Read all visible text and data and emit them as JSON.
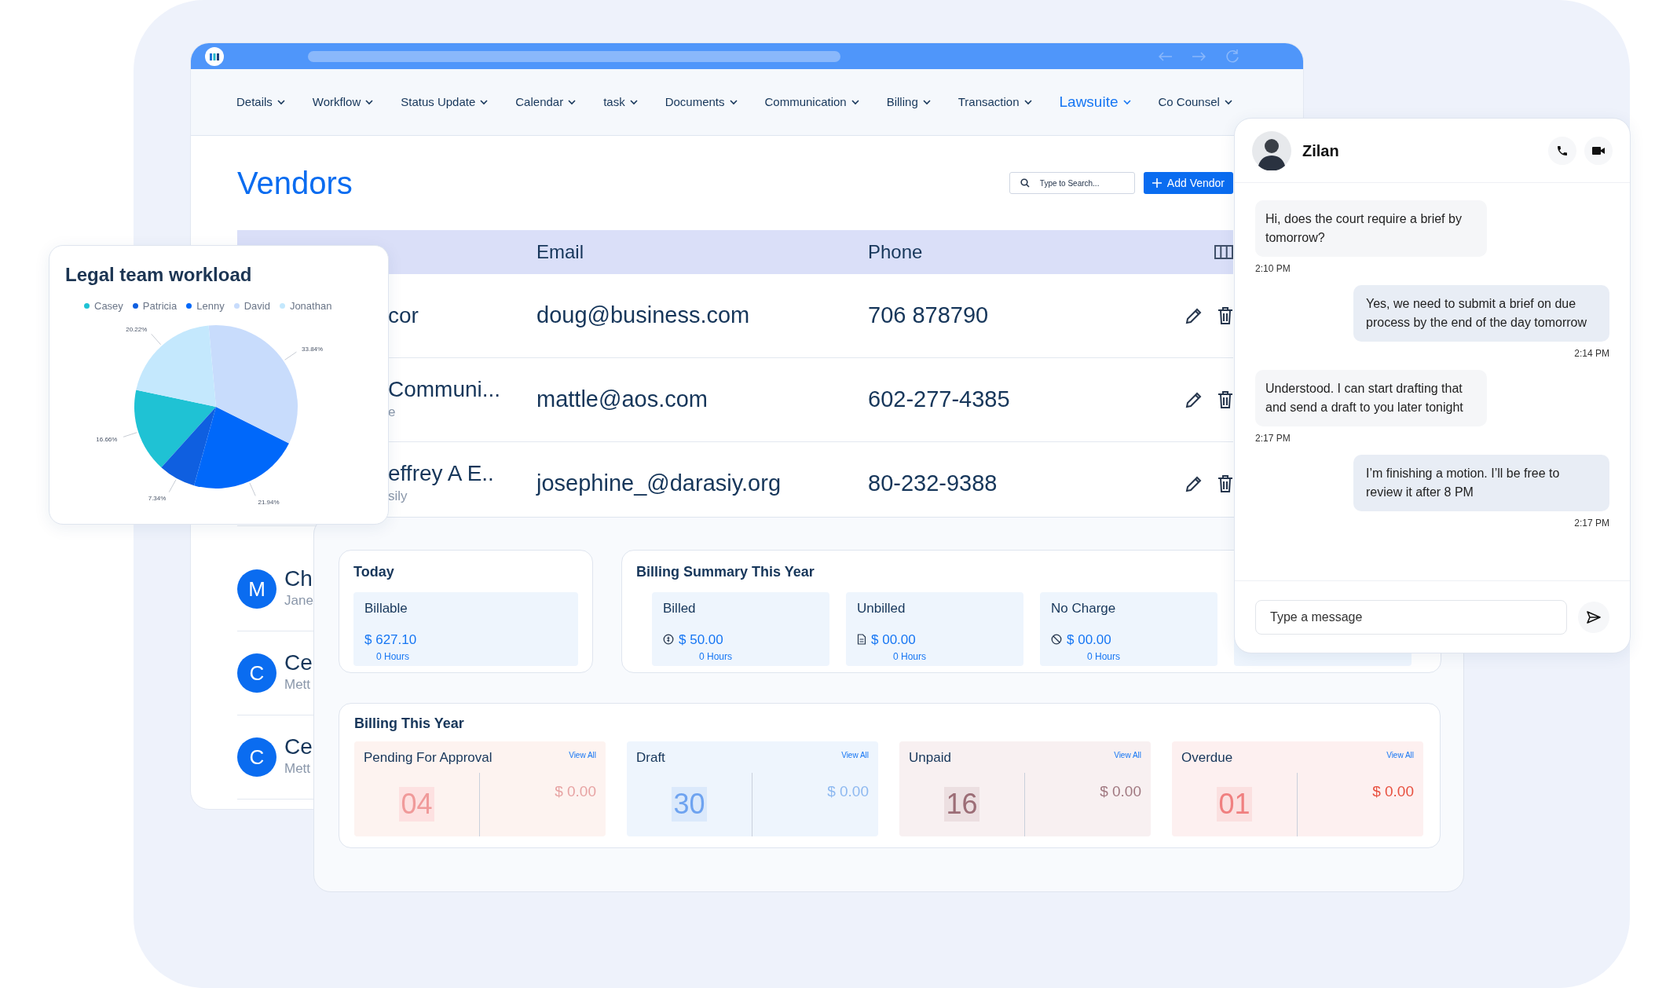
{
  "browser": {
    "nav": [
      {
        "label": "Details",
        "selected": false
      },
      {
        "label": "Workflow",
        "selected": false
      },
      {
        "label": "Status Update",
        "selected": false
      },
      {
        "label": "Calendar",
        "selected": false
      },
      {
        "label": "task",
        "selected": false
      },
      {
        "label": "Documents",
        "selected": false
      },
      {
        "label": "Communication",
        "selected": false
      },
      {
        "label": "Billing",
        "selected": false
      },
      {
        "label": "Transaction",
        "selected": false
      },
      {
        "label": "Lawsuite",
        "selected": true
      },
      {
        "label": "Co Counsel",
        "selected": false
      }
    ]
  },
  "vendors": {
    "title": "Vendors",
    "search": {
      "placeholder": "Type to Search..."
    },
    "add_button": "Add Vendor",
    "columns": [
      "Email",
      "Phone"
    ],
    "rows": [
      {
        "name": "cor",
        "email": "doug@business.com",
        "phone": "706 878790"
      },
      {
        "name": "Communi...",
        "subtitle": "e",
        "email": "mattle@aos.com",
        "phone": "602-277-4385"
      },
      {
        "name": "effrey A E..",
        "subtitle": "sily",
        "email": "josephine_@darasiy.org",
        "phone": "80-232-9388"
      }
    ]
  },
  "contacts": [
    {
      "initial": "M",
      "name": "Ch",
      "subtitle": "Jane"
    },
    {
      "initial": "C",
      "name": "Ce",
      "subtitle": "Mett"
    },
    {
      "initial": "C",
      "name": "Ce",
      "subtitle": "Mett"
    }
  ],
  "workload_card": {
    "chart_data": {
      "type": "pie",
      "title": "Legal team workload",
      "categories": [
        "Casey",
        "Patricia",
        "Lenny",
        "David",
        "Jonathan"
      ],
      "colors": [
        "#1fc2d4",
        "#0f5fe0",
        "#0068fa",
        "#c8dcfc",
        "#c4e8fd"
      ],
      "legend": "top",
      "series": [
        {
          "values": [
            16.66,
            7.34,
            21.94,
            33.84,
            20.22
          ]
        }
      ],
      "value_labels": [
        "16.66%",
        "7.34%",
        "21.94%",
        "33.84%",
        "20.22%"
      ]
    }
  },
  "today": {
    "title": "Today",
    "tiles": [
      {
        "label": "Billable",
        "amount": "$ 627.10",
        "hours": "0 Hours"
      }
    ]
  },
  "billing_summary": {
    "title": "Billing Summary This Year",
    "tiles": [
      {
        "kind": "billed",
        "label": "Billed",
        "amount": "$ 50.00",
        "hours": "0 Hours"
      },
      {
        "kind": "unbilled",
        "label": "Unbilled",
        "amount": "$ 00.00",
        "hours": "0 Hours"
      },
      {
        "kind": "no_charge",
        "label": "No Charge",
        "amount": "$ 00.00",
        "hours": "0 Hours"
      }
    ]
  },
  "billing_year": {
    "title": "Billing This Year",
    "tiles": [
      {
        "kind": "pending",
        "label": "Pending For Approval",
        "link": "View All",
        "count": "04",
        "amount": "$ 0.00"
      },
      {
        "kind": "draft",
        "label": "Draft",
        "link": "View All",
        "count": "30",
        "amount": "$ 0.00"
      },
      {
        "kind": "unpaid",
        "label": "Unpaid",
        "link": "View All",
        "count": "16",
        "amount": "$ 0.00"
      },
      {
        "kind": "overdue",
        "label": "Overdue",
        "link": "View All",
        "count": "01",
        "amount": "$ 0.00"
      }
    ]
  },
  "chat": {
    "contact": "Zilan",
    "messages": [
      {
        "kind": "incoming",
        "text": "Hi, does the court require a brief by tomorrow?",
        "time": "2:10 PM"
      },
      {
        "kind": "outgoing",
        "text": "Yes, we need to submit a brief on due process by the end of the day tomorrow",
        "time": "2:14 PM"
      },
      {
        "kind": "incoming",
        "text": "Understood. I can start drafting that and send a draft to you later tonight",
        "time": "2:17 PM"
      },
      {
        "kind": "outgoing",
        "text": "I’m finishing a motion. I’ll be free to review it after 8 PM",
        "time": "2:17 PM"
      }
    ],
    "input": {
      "placeholder": "Type a message"
    }
  }
}
